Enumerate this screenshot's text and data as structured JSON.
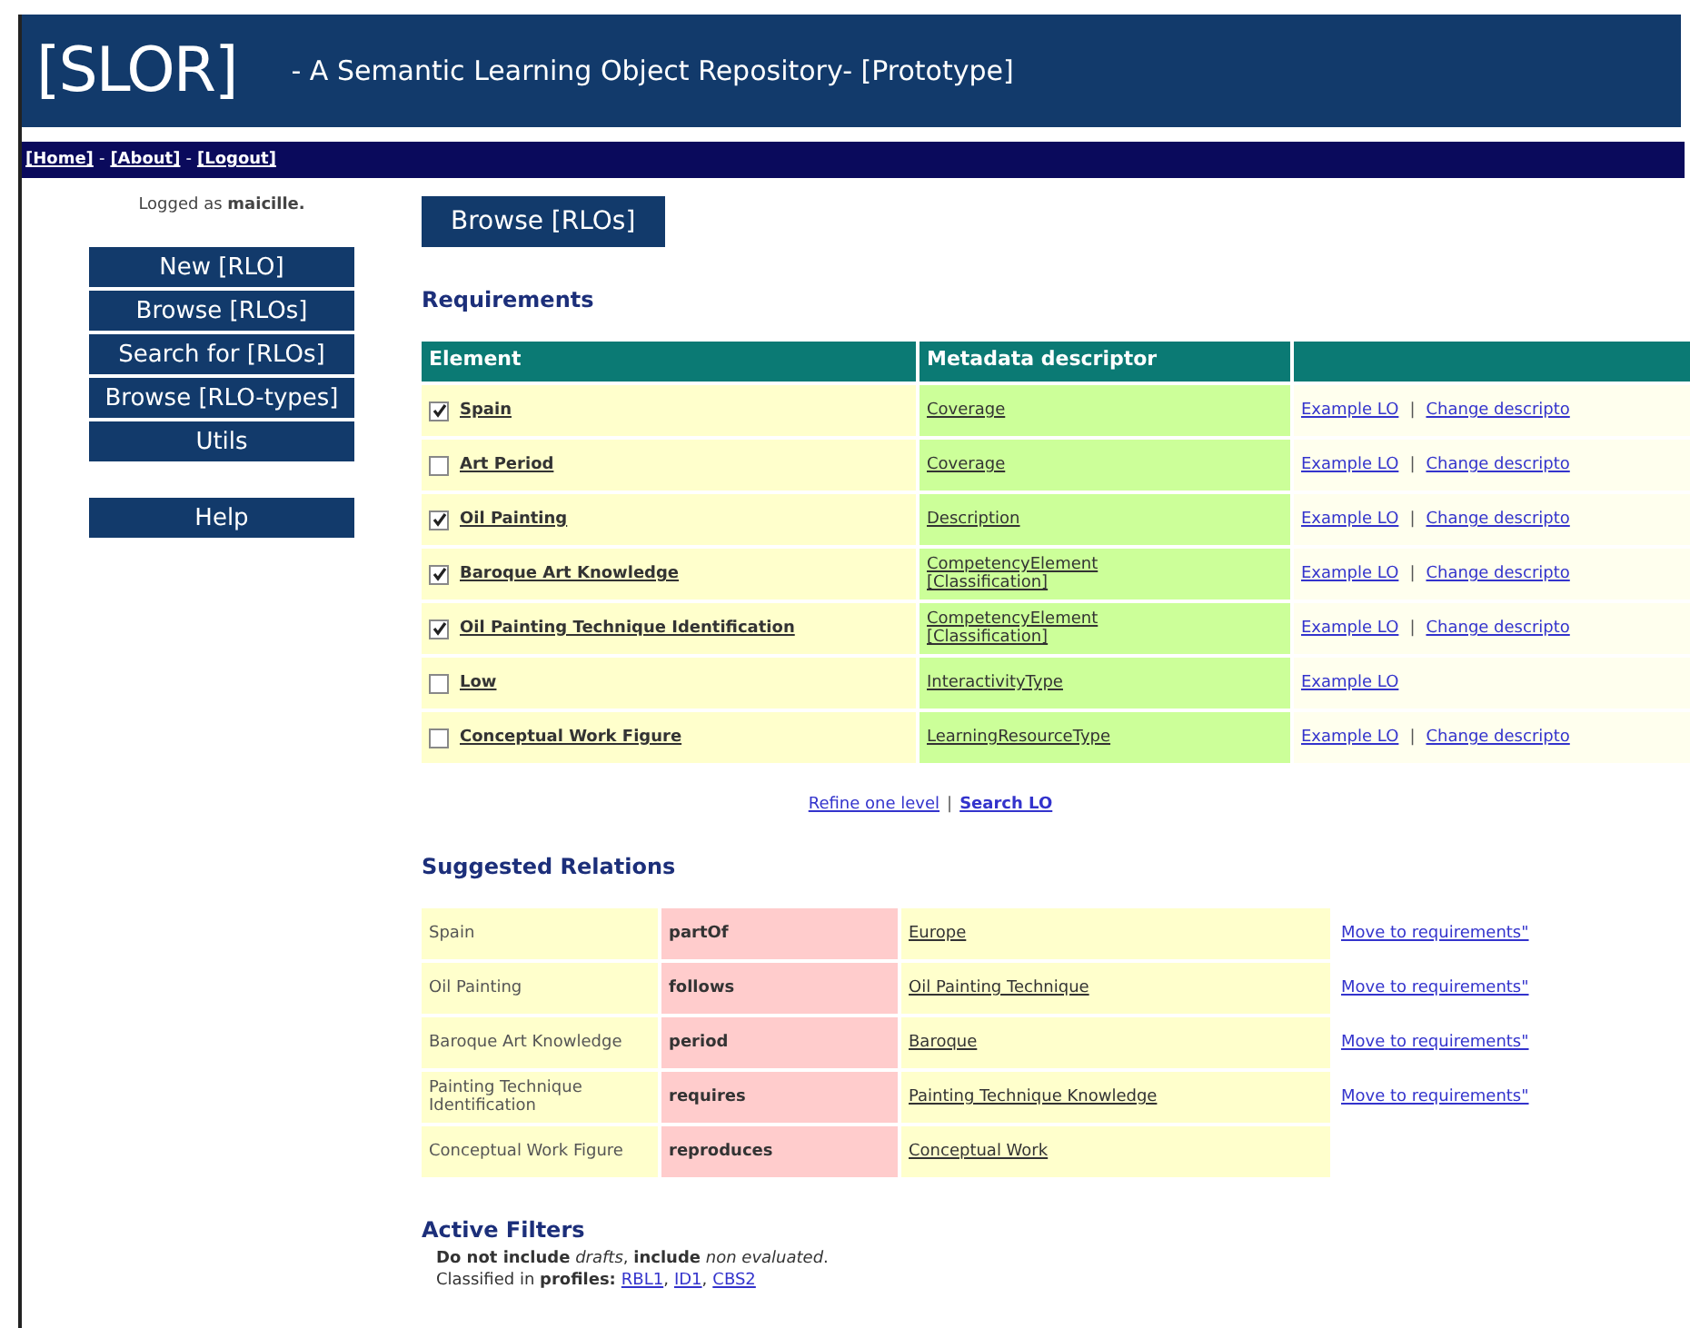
{
  "header": {
    "logo": "[SLOR]",
    "subtitle": "- A Semantic Learning Object Repository- [Prototype]"
  },
  "nav": {
    "links": [
      "[Home]",
      "[About]",
      "[Logout]"
    ],
    "separator": "-"
  },
  "sidebar": {
    "logged_in": "Logged as **maicille.**",
    "menu": [
      "New [RLO]",
      "Browse [RLOs]",
      "Search for [RLOs]",
      "Browse [RLO-types]",
      "Utils"
    ],
    "help": "Help"
  },
  "page_title": "Browse [RLOs]",
  "requirements": {
    "heading": "Requirements",
    "columns": [
      "Element",
      "Metadata descriptor"
    ],
    "rows": [
      {
        "element": "Spain",
        "checked": true,
        "descriptor": [
          "Coverage"
        ],
        "actions": [
          "Example LO",
          "Change descripto"
        ]
      },
      {
        "element": "Art Period",
        "checked": false,
        "descriptor": [
          "Coverage"
        ],
        "actions": [
          "Example LO",
          "Change descripto"
        ]
      },
      {
        "element": "Oil Painting",
        "checked": true,
        "descriptor": [
          "Description"
        ],
        "actions": [
          "Example LO",
          "Change descripto"
        ]
      },
      {
        "element": "Baroque Art Knowledge",
        "checked": true,
        "descriptor": [
          "CompetencyElement",
          "[Classification]"
        ],
        "actions": [
          "Example LO",
          "Change descripto"
        ]
      },
      {
        "element": "Oil Painting Technique Identification",
        "checked": true,
        "descriptor": [
          "CompetencyElement",
          "[Classification]"
        ],
        "actions": [
          "Example LO",
          "Change descripto"
        ]
      },
      {
        "element": "Low",
        "checked": false,
        "descriptor": [
          "InteractivityType"
        ],
        "actions": [
          "Example LO"
        ]
      },
      {
        "element": "Conceptual Work Figure",
        "checked": false,
        "descriptor": [
          "LearningResourceType"
        ],
        "actions": [
          "Example LO",
          "Change descripto"
        ]
      }
    ],
    "action_separator": "|",
    "footer_links": [
      {
        "label": "Refine one level",
        "bold": false
      },
      {
        "label": "Search LO",
        "bold": true
      }
    ],
    "footer_separator": "|"
  },
  "relations": {
    "heading": "Suggested Relations",
    "rows": [
      {
        "subject": "Spain",
        "relation": "partOf",
        "object": "Europe",
        "action": "Move to requirements\""
      },
      {
        "subject": "Oil Painting",
        "relation": "follows",
        "object": "Oil Painting Technique",
        "action": "Move to requirements\""
      },
      {
        "subject": "Baroque Art Knowledge",
        "relation": "period",
        "object": "Baroque",
        "action": "Move to requirements\""
      },
      {
        "subject": "Painting Technique Identification",
        "relation": "requires",
        "object": "Painting Technique Knowledge",
        "action": "Move to requirements\""
      },
      {
        "subject": "Conceptual Work Figure",
        "relation": "reproduces",
        "object": "Conceptual Work"
      }
    ]
  },
  "filters": {
    "heading": "Active Filters",
    "line": "**Do not include** *drafts*, **include** *non evaluated*.",
    "profiles_label": "Classified in **profiles:**",
    "profiles": [
      "RBL1",
      "ID1",
      "CBS2"
    ],
    "separator": ","
  }
}
